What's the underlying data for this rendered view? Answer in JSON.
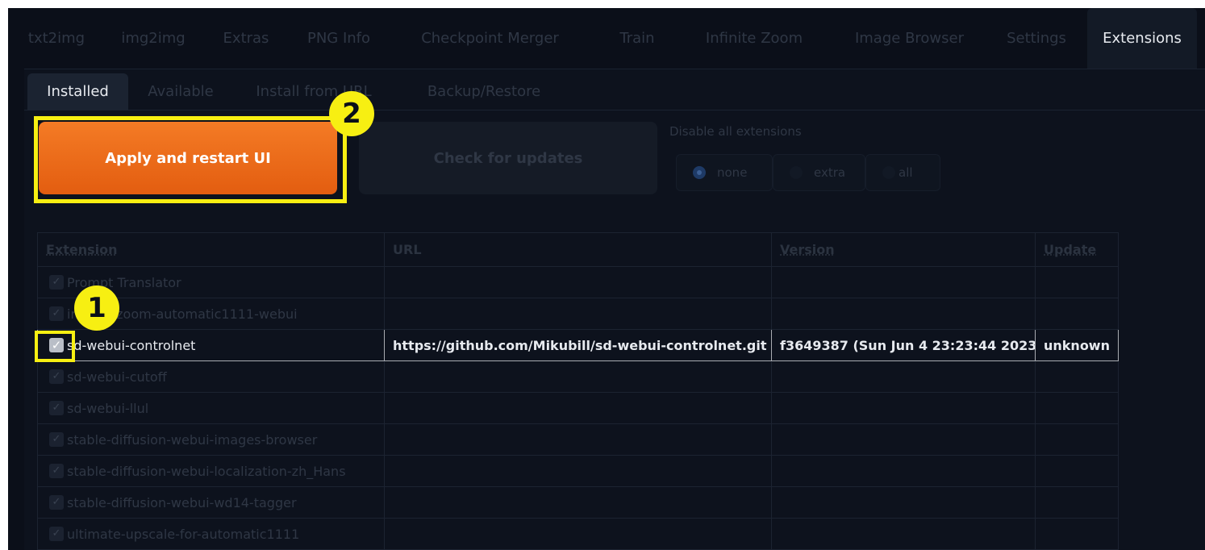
{
  "top_tabs": [
    "txt2img",
    "img2img",
    "Extras",
    "PNG Info",
    "Checkpoint Merger",
    "Train",
    "Infinite Zoom",
    "Image Browser",
    "Settings",
    "Extensions"
  ],
  "active_top_tab": "Extensions",
  "sub_tabs": [
    "Installed",
    "Available",
    "Install from URL",
    "Backup/Restore"
  ],
  "active_sub_tab": "Installed",
  "apply_button_label": "Apply and restart UI",
  "check_button_label": "Check for updates",
  "disable_group": {
    "label": "Disable all extensions",
    "options": [
      "none",
      "extra",
      "all"
    ],
    "selected": "none"
  },
  "table": {
    "headers": [
      "Extension",
      "URL",
      "Version",
      "Update"
    ],
    "rows": [
      {
        "name": "Prompt Translator",
        "url": "",
        "version": "",
        "update": "",
        "checked": true
      },
      {
        "name": "infinite-zoom-automatic1111-webui",
        "url": "",
        "version": "",
        "update": "",
        "checked": true
      },
      {
        "name": "sd-webui-controlnet",
        "url": "https://github.com/Mikubill/sd-webui-controlnet.git",
        "version": "f3649387 (Sun Jun 4 23:23:44 2023)",
        "update": "unknown",
        "checked": true
      },
      {
        "name": "sd-webui-cutoff",
        "url": "",
        "version": "",
        "update": "",
        "checked": true
      },
      {
        "name": "sd-webui-llul",
        "url": "",
        "version": "",
        "update": "",
        "checked": true
      },
      {
        "name": "stable-diffusion-webui-images-browser",
        "url": "",
        "version": "",
        "update": "",
        "checked": true
      },
      {
        "name": "stable-diffusion-webui-localization-zh_Hans",
        "url": "",
        "version": "",
        "update": "",
        "checked": true
      },
      {
        "name": "stable-diffusion-webui-wd14-tagger",
        "url": "",
        "version": "",
        "update": "",
        "checked": true
      },
      {
        "name": "ultimate-upscale-for-automatic1111",
        "url": "",
        "version": "",
        "update": "",
        "checked": true
      }
    ]
  },
  "annotations": {
    "step1": "1",
    "step2": "2"
  },
  "colors": {
    "accent": "#f47b25",
    "highlight": "#f7ef12",
    "background": "#0b0f19"
  }
}
